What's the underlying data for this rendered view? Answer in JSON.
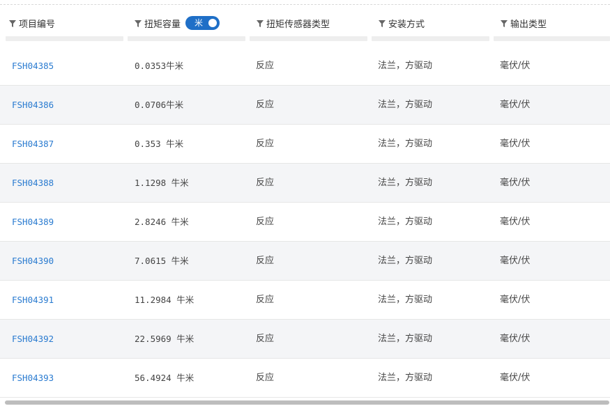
{
  "columns": {
    "project_no": "项目编号",
    "torque_capacity": "扭矩容量",
    "sensor_type": "扭矩传感器类型",
    "mounting": "安装方式",
    "output_type": "输出类型"
  },
  "unit_toggle": {
    "label": "米",
    "on": true,
    "color": "#1f6fc7"
  },
  "rows": [
    {
      "id": "FSH04385",
      "torque": "0.0353牛米",
      "sensor": "反应",
      "mount": "法兰，方驱动",
      "output": "毫伏/伏"
    },
    {
      "id": "FSH04386",
      "torque": "0.0706牛米",
      "sensor": "反应",
      "mount": "法兰，方驱动",
      "output": "毫伏/伏"
    },
    {
      "id": "FSH04387",
      "torque": "0.353 牛米",
      "sensor": "反应",
      "mount": "法兰，方驱动",
      "output": "毫伏/伏"
    },
    {
      "id": "FSH04388",
      "torque": "1.1298 牛米",
      "sensor": "反应",
      "mount": "法兰，方驱动",
      "output": "毫伏/伏"
    },
    {
      "id": "FSH04389",
      "torque": "2.8246 牛米",
      "sensor": "反应",
      "mount": "法兰，方驱动",
      "output": "毫伏/伏"
    },
    {
      "id": "FSH04390",
      "torque": "7.0615 牛米",
      "sensor": "反应",
      "mount": "法兰，方驱动",
      "output": "毫伏/伏"
    },
    {
      "id": "FSH04391",
      "torque": "11.2984 牛米",
      "sensor": "反应",
      "mount": "法兰，方驱动",
      "output": "毫伏/伏"
    },
    {
      "id": "FSH04392",
      "torque": "22.5969 牛米",
      "sensor": "反应",
      "mount": "法兰，方驱动",
      "output": "毫伏/伏"
    },
    {
      "id": "FSH04393",
      "torque": "56.4924 牛米",
      "sensor": "反应",
      "mount": "法兰，方驱动",
      "output": "毫伏/伏"
    }
  ],
  "colors": {
    "link": "#2a7bd0",
    "alt_row": "#f4f5f7",
    "accent": "#1f6fc7"
  },
  "icons": {
    "filter": "filter-funnel-icon"
  }
}
